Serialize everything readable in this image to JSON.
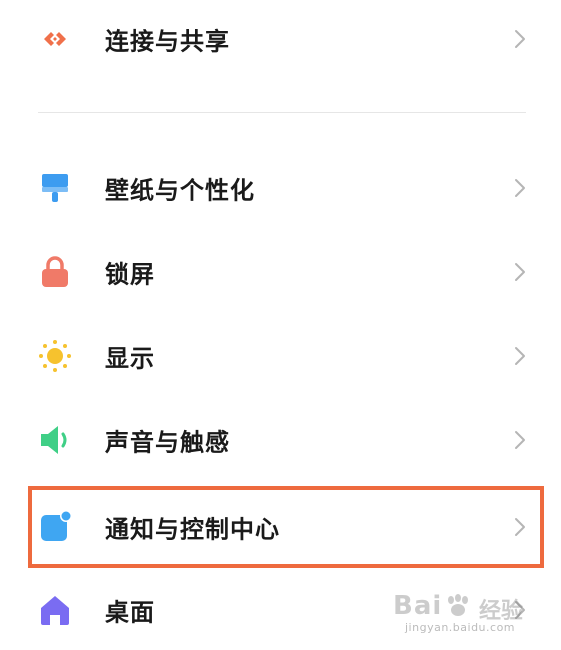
{
  "settings": {
    "items": [
      {
        "id": "connect-share",
        "label": "连接与共享",
        "icon": "connect-share-icon",
        "color": "#f0704a"
      },
      {
        "id": "wallpaper",
        "label": "壁纸与个性化",
        "icon": "paint-brush-icon",
        "color": "#3d9cf0"
      },
      {
        "id": "lockscreen",
        "label": "锁屏",
        "icon": "lock-icon",
        "color": "#f07a68"
      },
      {
        "id": "display",
        "label": "显示",
        "icon": "sun-icon",
        "color": "#f6c22e"
      },
      {
        "id": "sound",
        "label": "声音与触感",
        "icon": "speaker-icon",
        "color": "#3fcf86"
      },
      {
        "id": "notifications",
        "label": "通知与控制中心",
        "icon": "notification-icon",
        "color": "#3fa6f2"
      },
      {
        "id": "desktop",
        "label": "桌面",
        "icon": "home-icon",
        "color": "#7a6cf2"
      }
    ]
  },
  "highlight": {
    "color": "#ee6a3e",
    "target": "notifications"
  },
  "watermark": {
    "logo_text": "Bai",
    "logo_suffix": "经验",
    "url": "jingyan.baidu.com"
  }
}
